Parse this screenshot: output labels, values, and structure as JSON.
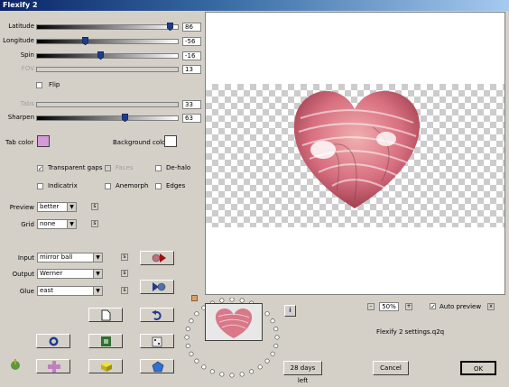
{
  "window": {
    "title": "Flexify 2"
  },
  "sliders": [
    {
      "label": "Latitude",
      "value": "86",
      "level": 0.94,
      "enabled": true
    },
    {
      "label": "Longitude",
      "value": "-56",
      "level": 0.34,
      "enabled": true
    },
    {
      "label": "Spin",
      "value": "-16",
      "level": 0.45,
      "enabled": true
    },
    {
      "label": "FOV",
      "value": "13",
      "level": null,
      "enabled": false
    }
  ],
  "flip": {
    "label": "Flip",
    "checked": false
  },
  "sliders2": [
    {
      "label": "Tabs",
      "value": "33",
      "level": null,
      "enabled": false
    },
    {
      "label": "Sharpen",
      "value": "63",
      "level": 0.62,
      "enabled": true
    }
  ],
  "tab_color": {
    "label": "Tab color",
    "color": "#d79ad8"
  },
  "background_color": {
    "label": "Background color",
    "color": "#ffffff"
  },
  "options": {
    "transparent_gaps": {
      "label": "Transparent gaps",
      "checked": true,
      "enabled": true
    },
    "faces": {
      "label": "Faces",
      "checked": false,
      "enabled": false
    },
    "de_halo": {
      "label": "De-halo",
      "checked": false,
      "enabled": true
    },
    "indicatrix": {
      "label": "Indicatrix",
      "checked": false,
      "enabled": true
    },
    "anemorph": {
      "label": "Anemorph",
      "checked": false,
      "enabled": true
    },
    "edges": {
      "label": "Edges",
      "checked": false,
      "enabled": true
    }
  },
  "preview_quality": {
    "label": "Preview",
    "value": "better",
    "s": "s"
  },
  "grid": {
    "label": "Grid",
    "value": "none",
    "s": "s"
  },
  "input": {
    "label": "Input",
    "value": "mirror ball",
    "s": "s"
  },
  "output": {
    "label": "Output",
    "value": "Werner",
    "s": "s"
  },
  "glue": {
    "label": "Glue",
    "value": "east",
    "s": "s"
  },
  "zoom": {
    "minus": "-",
    "value": "50%",
    "plus": "+"
  },
  "auto_preview": {
    "label": "Auto preview",
    "checked": true,
    "x": "x"
  },
  "info_icon_text": "i",
  "settings_file": "Flexify 2 settings.q2q",
  "days_left_button": "28 days left",
  "cancel_button": "Cancel",
  "ok_button": "OK",
  "icons": [
    "tools-icon",
    "grid-icon",
    "cube-icon",
    "gem-icon",
    "circle-icon",
    "frame-icon",
    "dice-icon",
    "page-icon",
    "undo-icon",
    "play-forward-icon",
    "play-backward-icon"
  ]
}
